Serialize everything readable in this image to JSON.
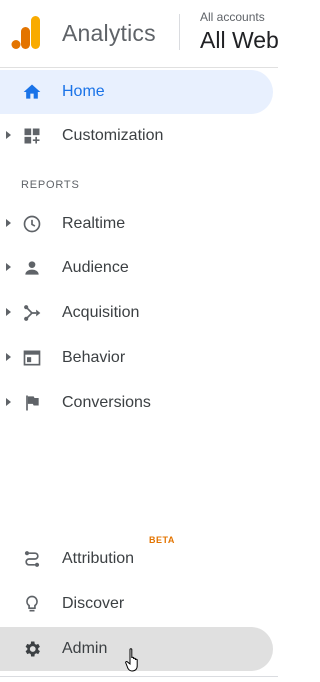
{
  "header": {
    "brand": "Analytics",
    "account_small": "All accounts",
    "account_big": "All Web"
  },
  "nav": {
    "home": "Home",
    "customization": "Customization",
    "reports_heading": "REPORTS",
    "realtime": "Realtime",
    "audience": "Audience",
    "acquisition": "Acquisition",
    "behavior": "Behavior",
    "conversions": "Conversions",
    "attribution": "Attribution",
    "attribution_badge": "BETA",
    "discover": "Discover",
    "admin": "Admin"
  },
  "colors": {
    "accent": "#1a73e8",
    "active_bg": "#e8f0fe",
    "beta": "#e37400",
    "logo_orange": "#f9ab00",
    "logo_dark_orange": "#e37400"
  },
  "icons": {
    "home": "home-icon",
    "customization": "dashboard-plus-icon",
    "realtime": "clock-icon",
    "audience": "person-icon",
    "acquisition": "fork-icon",
    "behavior": "window-icon",
    "conversions": "flag-icon",
    "attribution": "route-icon",
    "discover": "lightbulb-icon",
    "admin": "gear-icon"
  }
}
